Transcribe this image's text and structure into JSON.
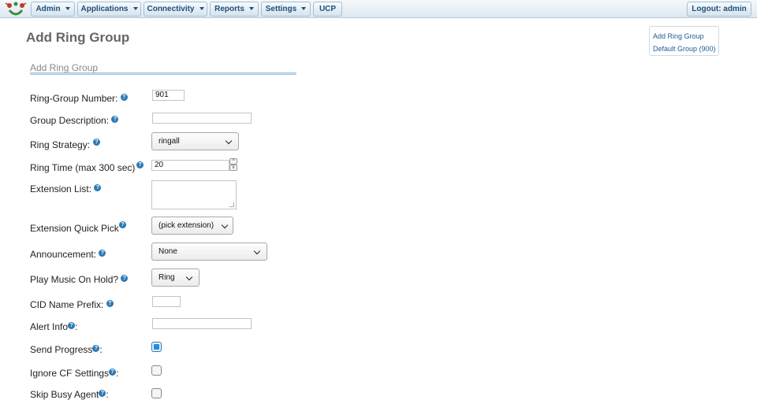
{
  "menu": {
    "items": [
      {
        "label": "Admin",
        "dropdown": true
      },
      {
        "label": "Applications",
        "dropdown": true
      },
      {
        "label": "Connectivity",
        "dropdown": true
      },
      {
        "label": "Reports",
        "dropdown": true
      },
      {
        "label": "Settings",
        "dropdown": true
      },
      {
        "label": "UCP",
        "dropdown": false
      }
    ],
    "logout": "Logout: admin"
  },
  "page": {
    "title": "Add Ring Group",
    "section": "Add Ring Group"
  },
  "side_panel": {
    "links": [
      "Add Ring Group",
      "Default Group (900)"
    ]
  },
  "form": {
    "ring_group_number": {
      "label": "Ring-Group Number:",
      "value": "901"
    },
    "group_description": {
      "label": "Group Description:",
      "value": ""
    },
    "ring_strategy": {
      "label": "Ring Strategy:",
      "value": "ringall"
    },
    "ring_time": {
      "label": "Ring Time (max 300 sec)",
      "value": "20"
    },
    "extension_list": {
      "label": "Extension List:",
      "value": ""
    },
    "extension_quick_pick": {
      "label": "Extension Quick Pick",
      "value": "(pick extension)"
    },
    "announcement": {
      "label": "Announcement:",
      "value": "None"
    },
    "play_moh": {
      "label": "Play Music On Hold?",
      "value": "Ring"
    },
    "cid_name_prefix": {
      "label": "CID Name Prefix:",
      "value": ""
    },
    "alert_info": {
      "label": "Alert Info",
      "suffix": ":",
      "value": ""
    },
    "send_progress": {
      "label": "Send Progress",
      "suffix": ":",
      "checked": true
    },
    "ignore_cf": {
      "label": "Ignore CF Settings",
      "suffix": ":",
      "checked": false
    },
    "skip_busy": {
      "label": "Skip Busy Agent",
      "suffix": ":",
      "checked": false
    }
  },
  "help_glyph": "?",
  "colors": {
    "accent": "#2a7ab7",
    "menu_text": "#1d4f7a",
    "title": "#666666"
  }
}
